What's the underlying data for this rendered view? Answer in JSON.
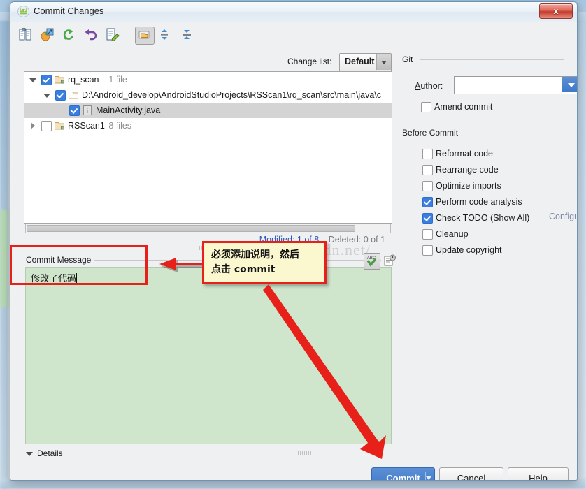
{
  "window": {
    "title": "Commit Changes",
    "app_icon": "android-robot-icon",
    "close_label": "x"
  },
  "toolbar": {
    "icons": [
      {
        "name": "show-diff-icon",
        "glyph": "diff"
      },
      {
        "name": "revert-icon",
        "glyph": "move-to-changelist"
      },
      {
        "name": "refresh-icon",
        "glyph": "refresh"
      },
      {
        "name": "rollback-icon",
        "glyph": "rollback"
      },
      {
        "name": "edit-source-icon",
        "glyph": "edit"
      },
      {
        "name": "group-by-directory-icon",
        "glyph": "group",
        "pressed": true
      },
      {
        "name": "expand-all-icon",
        "glyph": "expand"
      },
      {
        "name": "collapse-all-icon",
        "glyph": "collapse"
      }
    ]
  },
  "changelist": {
    "label": "Change list:",
    "label_mnemonic": "t",
    "selected": "Default",
    "options": [
      "Default"
    ]
  },
  "tree": {
    "rows": [
      {
        "indent": 0,
        "twisty": "down",
        "checked": true,
        "icon": "module-folder-icon",
        "label": "rq_scan",
        "sub": "1 file",
        "selected": false
      },
      {
        "indent": 1,
        "twisty": "down",
        "checked": true,
        "icon": "folder-icon",
        "label": "D:\\Android_develop\\AndroidStudioProjects\\RSScan1\\rq_scan\\src\\main\\java\\c",
        "sub": "",
        "selected": false
      },
      {
        "indent": 2,
        "twisty": "none",
        "checked": true,
        "icon": "java-file-icon",
        "label": "MainActivity.java",
        "sub": "",
        "selected": true
      },
      {
        "indent": 0,
        "twisty": "right",
        "checked": false,
        "icon": "module-folder-icon",
        "label": "RSScan1",
        "sub": "8 files",
        "selected": false
      }
    ]
  },
  "status": {
    "modified": "Modified: 1 of 8",
    "deleted": "Deleted: 0 of 1"
  },
  "commit_message": {
    "title": "Commit Message",
    "value": "修改了代码",
    "spellcheck_icon": "spellcheck-abc-icon",
    "history_icon": "message-history-icon"
  },
  "git": {
    "group_title": "Git",
    "author_label": "Author:",
    "author_mnemonic": "A",
    "author_value": "",
    "amend": {
      "label": "Amend commit",
      "checked": false,
      "mnemonic": "m"
    }
  },
  "before_commit": {
    "group_title": "Before Commit",
    "items": [
      {
        "label": "Reformat code",
        "checked": false
      },
      {
        "label": "Rearrange code",
        "checked": false
      },
      {
        "label": "Optimize imports",
        "checked": false
      },
      {
        "label": "Perform code analysis",
        "checked": true
      },
      {
        "label": "Check TODO (Show All)",
        "checked": true,
        "link": "Configure"
      },
      {
        "label": "Cleanup",
        "checked": false
      },
      {
        "label": "Update copyright",
        "checked": false
      }
    ]
  },
  "details": {
    "label": "Details",
    "expanded": true
  },
  "buttons": {
    "commit": "Commit",
    "cancel": "Cancel",
    "help": "Help"
  },
  "annotations": {
    "callout_line1": "必须添加说明，然后",
    "callout_line2": "点击 commit",
    "watermark": "http://blog.csdn.net/"
  },
  "colors": {
    "accent_blue": "#3e78c7",
    "checkbox_blue": "#3a7fe0",
    "annotation_red": "#e8201a",
    "callout_bg": "#fbf8d0",
    "message_bg": "#cfe6cc",
    "link_blue": "#2a56b8"
  }
}
